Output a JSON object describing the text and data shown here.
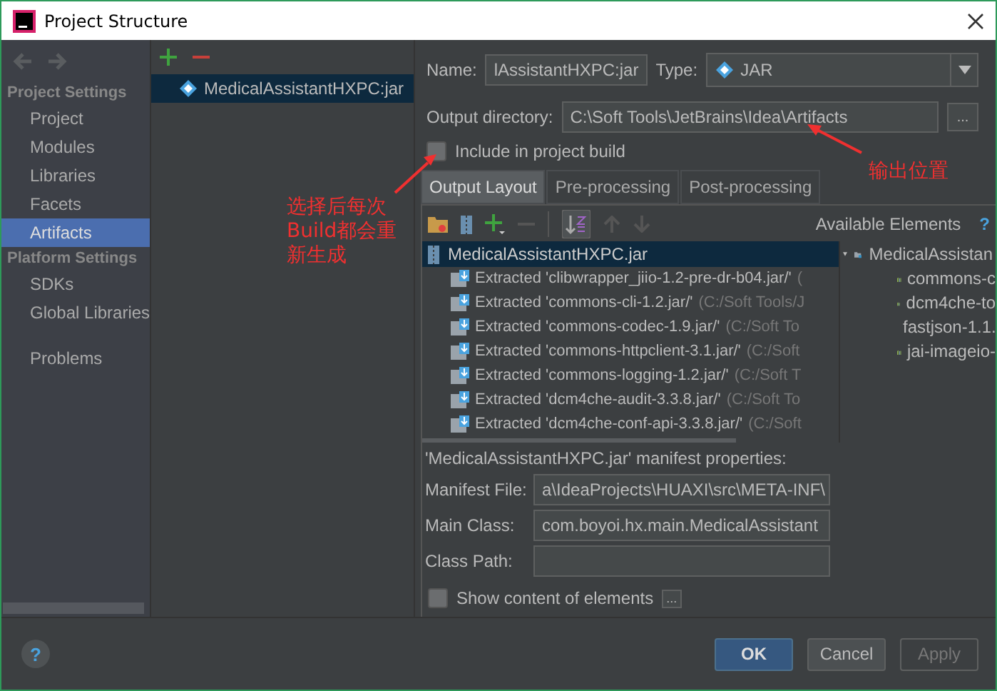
{
  "window": {
    "title": "Project Structure"
  },
  "sidebar": {
    "sections": [
      {
        "heading": "Project Settings",
        "items": [
          {
            "label": "Project",
            "selected": false
          },
          {
            "label": "Modules",
            "selected": false
          },
          {
            "label": "Libraries",
            "selected": false
          },
          {
            "label": "Facets",
            "selected": false
          },
          {
            "label": "Artifacts",
            "selected": true
          }
        ]
      },
      {
        "heading": "Platform Settings",
        "items": [
          {
            "label": "SDKs",
            "selected": false
          },
          {
            "label": "Global Libraries",
            "selected": false
          }
        ]
      }
    ],
    "extra_items": [
      {
        "label": "Problems",
        "selected": false
      }
    ]
  },
  "artifacts": [
    {
      "label": "MedicalAssistantHXPC:jar",
      "selected": true
    }
  ],
  "name_field": {
    "label": "Name:",
    "value": "lAssistantHXPC:jar"
  },
  "type_field": {
    "label": "Type:",
    "value": "JAR"
  },
  "output_directory": {
    "label": "Output directory:",
    "value": "C:\\Soft Tools\\JetBrains\\Idea\\Artifacts",
    "browse": "..."
  },
  "include_in_build": {
    "label": "Include in project build",
    "checked": false
  },
  "tabs": [
    {
      "label": "Output Layout",
      "selected": true
    },
    {
      "label": "Pre-processing",
      "selected": false
    },
    {
      "label": "Post-processing",
      "selected": false
    }
  ],
  "layout_tree": {
    "label": "MedicalAssistantHXPC.jar",
    "selected": true,
    "children": [
      {
        "name": "Extracted 'clibwrapper_jiio-1.2-pre-dr-b04.jar/'",
        "path": "("
      },
      {
        "name": "Extracted 'commons-cli-1.2.jar/'",
        "path": "(C:/Soft Tools/J"
      },
      {
        "name": "Extracted 'commons-codec-1.9.jar/'",
        "path": "(C:/Soft To"
      },
      {
        "name": "Extracted 'commons-httpclient-3.1.jar/'",
        "path": "(C:/Soft"
      },
      {
        "name": "Extracted 'commons-logging-1.2.jar/'",
        "path": "(C:/Soft T"
      },
      {
        "name": "Extracted 'dcm4che-audit-3.3.8.jar/'",
        "path": "(C:/Soft To"
      },
      {
        "name": "Extracted 'dcm4che-conf-api-3.3.8.jar/'",
        "path": "(C:/Soft"
      }
    ]
  },
  "available_elements": {
    "title": "Available Elements",
    "help": "?",
    "root": {
      "label": "MedicalAssistan",
      "expanded": true,
      "children": [
        {
          "label": "commons-c"
        },
        {
          "label": "dcm4che-to"
        },
        {
          "label": "fastjson-1.1."
        },
        {
          "label": "jai-imageio-"
        }
      ]
    }
  },
  "manifest": {
    "heading": "'MedicalAssistantHXPC.jar' manifest properties:",
    "fields": [
      {
        "label": "Manifest File:",
        "value": "a\\IdeaProjects\\HUAXI\\src\\META-INF\\"
      },
      {
        "label": "Main Class:",
        "value": "com.boyoi.hx.main.MedicalAssistant"
      },
      {
        "label": "Class Path:"
      }
    ]
  },
  "show_content": {
    "label": "Show content of elements",
    "checked": false,
    "more": "..."
  },
  "help_button": "?",
  "buttons": [
    {
      "label": "OK",
      "kind": "primary",
      "disabled": false
    },
    {
      "label": "Cancel",
      "kind": "normal",
      "disabled": false
    },
    {
      "label": "Apply",
      "kind": "normal",
      "disabled": true
    }
  ],
  "annotations": [
    {
      "text": "选择后每次Build都会重新生成"
    },
    {
      "text": "输出位置"
    }
  ]
}
